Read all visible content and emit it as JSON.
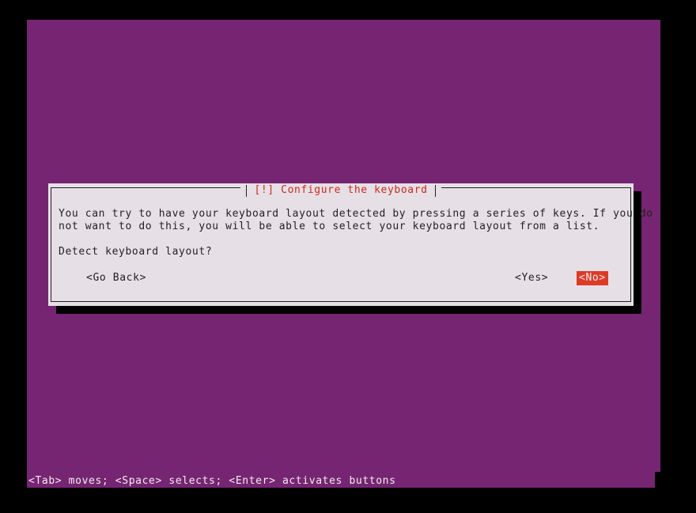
{
  "screen": {
    "background_color": "#000000",
    "console_color": "#762572"
  },
  "dialog": {
    "title": "[!] Configure the keyboard",
    "title_color": "#cc2a1e",
    "panel_color": "#e6e0e6",
    "body_text": "You can try to have your keyboard layout detected by pressing a series of keys. If you do\nnot want to do this, you will be able to select your keyboard layout from a list.",
    "question": "Detect keyboard layout?",
    "buttons": [
      {
        "label": "<Go Back>",
        "selected": false
      },
      {
        "label": "<Yes>",
        "selected": false
      },
      {
        "label": "<No>",
        "selected": true,
        "highlight_color": "#dd3b24",
        "highlight_text_color": "#f2ecf2"
      }
    ]
  },
  "statusbar": {
    "text": "<Tab> moves; <Space> selects; <Enter> activates buttons",
    "text_color": "#f2ecf2"
  }
}
